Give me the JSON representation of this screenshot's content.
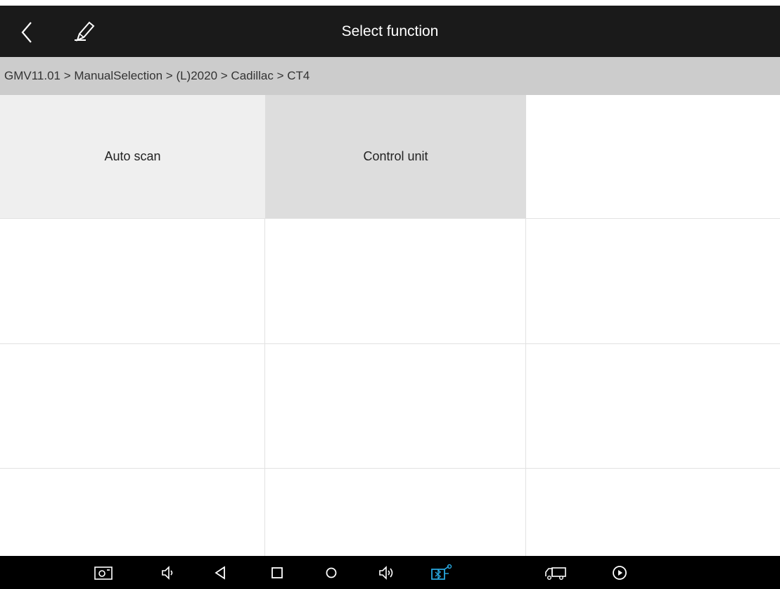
{
  "header": {
    "title": "Select function"
  },
  "breadcrumb": {
    "text": "GMV11.01 > ManualSelection > (L)2020 > Cadillac > CT4"
  },
  "functions": [
    {
      "label": "Auto scan"
    },
    {
      "label": "Control unit"
    }
  ],
  "navbar": {
    "icons": [
      "screenshot-icon",
      "volume-down-icon",
      "back-nav-icon",
      "home-square-icon",
      "circle-home-icon",
      "volume-up-icon",
      "vci-bluetooth-icon",
      "truck-icon",
      "play-icon"
    ]
  },
  "colors": {
    "top_bar": "#1a1a1a",
    "breadcrumb_bg": "#cccccc",
    "auto_scan_bg": "#efefef",
    "control_unit_bg": "#dddddd",
    "vci_accent": "#29a8e0"
  }
}
